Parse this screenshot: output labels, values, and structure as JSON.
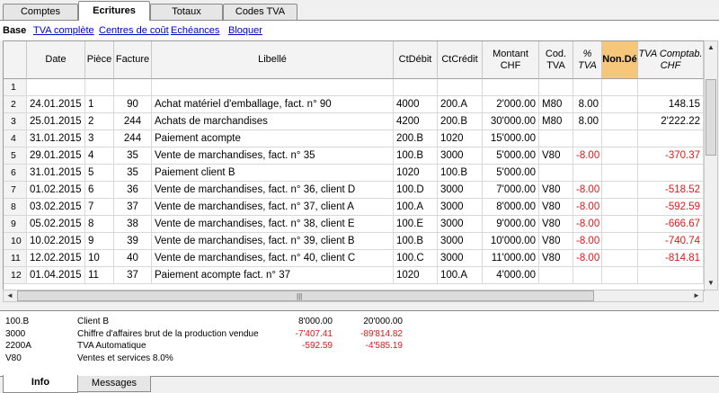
{
  "top_tabs": [
    "Comptes",
    "Ecritures",
    "Totaux",
    "Codes TVA"
  ],
  "active_top_tab": 1,
  "views": {
    "base": "Base",
    "links": [
      "TVA complète",
      "Centres de coût",
      "Echéances",
      "Bloquer"
    ]
  },
  "columns": [
    {
      "key": "date",
      "label": "Date"
    },
    {
      "key": "piece",
      "label": "Pièce"
    },
    {
      "key": "facture",
      "label": "Facture"
    },
    {
      "key": "libelle",
      "label": "Libellé"
    },
    {
      "key": "ctdebit",
      "label": "CtDébit"
    },
    {
      "key": "ctcredit",
      "label": "CtCrédit"
    },
    {
      "key": "montant",
      "label": "Montant CHF"
    },
    {
      "key": "codtva",
      "label": "Cod. TVA"
    },
    {
      "key": "pct",
      "label": "% TVA"
    },
    {
      "key": "nonde",
      "label": "Non.Dé"
    },
    {
      "key": "tvacompta",
      "label": "TVA Comptab. CHF"
    }
  ],
  "rows": [
    {
      "n": "1",
      "date": "",
      "piece": "",
      "facture": "",
      "libelle": "",
      "ctdebit": "",
      "ctcredit": "",
      "montant": "",
      "codtva": "",
      "pct": "",
      "nonde": "",
      "tvacompta": ""
    },
    {
      "n": "2",
      "date": "24.01.2015",
      "piece": "1",
      "facture": "90",
      "libelle": "Achat matériel d'emballage, fact. n° 90",
      "ctdebit": "4000",
      "ctcredit": "200.A",
      "montant": "2'000.00",
      "codtva": "M80",
      "pct": "8.00",
      "nonde": "",
      "tvacompta": "148.15"
    },
    {
      "n": "3",
      "date": "25.01.2015",
      "piece": "2",
      "facture": "244",
      "libelle": "Achats de marchandises",
      "ctdebit": "4200",
      "ctcredit": "200.B",
      "montant": "30'000.00",
      "codtva": "M80",
      "pct": "8.00",
      "nonde": "",
      "tvacompta": "2'222.22"
    },
    {
      "n": "4",
      "date": "31.01.2015",
      "piece": "3",
      "facture": "244",
      "libelle": "Paiement acompte",
      "ctdebit": "200.B",
      "ctcredit": "1020",
      "montant": "15'000.00",
      "codtva": "",
      "pct": "",
      "nonde": "",
      "tvacompta": ""
    },
    {
      "n": "5",
      "date": "29.01.2015",
      "piece": "4",
      "facture": "35",
      "libelle": "Vente de marchandises, fact. n° 35",
      "ctdebit": "100.B",
      "ctcredit": "3000",
      "montant": "5'000.00",
      "codtva": "V80",
      "pct": "-8.00",
      "nonde": "",
      "tvacompta": "-370.37"
    },
    {
      "n": "6",
      "date": "31.01.2015",
      "piece": "5",
      "facture": "35",
      "libelle": "Paiement client B",
      "ctdebit": "1020",
      "ctcredit": "100.B",
      "montant": "5'000.00",
      "codtva": "",
      "pct": "",
      "nonde": "",
      "tvacompta": ""
    },
    {
      "n": "7",
      "date": "01.02.2015",
      "piece": "6",
      "facture": "36",
      "libelle": "Vente de marchandises, fact. n° 36, client D",
      "ctdebit": "100.D",
      "ctcredit": "3000",
      "montant": "7'000.00",
      "codtva": "V80",
      "pct": "-8.00",
      "nonde": "",
      "tvacompta": "-518.52"
    },
    {
      "n": "8",
      "date": "03.02.2015",
      "piece": "7",
      "facture": "37",
      "libelle": "Vente de marchandises, fact. n° 37, client A",
      "ctdebit": "100.A",
      "ctcredit": "3000",
      "montant": "8'000.00",
      "codtva": "V80",
      "pct": "-8.00",
      "nonde": "",
      "tvacompta": "-592.59"
    },
    {
      "n": "9",
      "date": "05.02.2015",
      "piece": "8",
      "facture": "38",
      "libelle": "Vente de marchandises, fact. n° 38, client E",
      "ctdebit": "100.E",
      "ctcredit": "3000",
      "montant": "9'000.00",
      "codtva": "V80",
      "pct": "-8.00",
      "nonde": "",
      "tvacompta": "-666.67"
    },
    {
      "n": "10",
      "date": "10.02.2015",
      "piece": "9",
      "facture": "39",
      "libelle": "Vente de marchandises, fact. n° 39, client B",
      "ctdebit": "100.B",
      "ctcredit": "3000",
      "montant": "10'000.00",
      "codtva": "V80",
      "pct": "-8.00",
      "nonde": "",
      "tvacompta": "-740.74"
    },
    {
      "n": "11",
      "date": "12.02.2015",
      "piece": "10",
      "facture": "40",
      "libelle": "Vente de marchandises, fact. n° 40, client C",
      "ctdebit": "100.C",
      "ctcredit": "3000",
      "montant": "11'000.00",
      "codtva": "V80",
      "pct": "-8.00",
      "nonde": "",
      "tvacompta": "-814.81"
    },
    {
      "n": "12",
      "date": "01.04.2015",
      "piece": "11",
      "facture": "37",
      "libelle": "Paiement acompte fact. n° 37",
      "ctdebit": "1020",
      "ctcredit": "100.A",
      "montant": "4'000.00",
      "codtva": "",
      "pct": "",
      "nonde": "",
      "tvacompta": ""
    }
  ],
  "info_rows": [
    {
      "code": "100.B",
      "desc": "Client B",
      "v1": "8'000.00",
      "v2": "20'000.00"
    },
    {
      "code": "3000",
      "desc": "Chiffre d'affaires brut de la production vendue",
      "v1": "-7'407.41",
      "v2": "-89'814.82"
    },
    {
      "code": "2200A",
      "desc": "TVA Automatique",
      "v1": "-592.59",
      "v2": "-4'585.19"
    },
    {
      "code": "V80",
      "desc": "Ventes et services 8.0%",
      "v1": "",
      "v2": ""
    }
  ],
  "bottom_tabs": [
    "Info",
    "Messages"
  ],
  "active_bottom_tab": 0,
  "icons": {
    "scroll_up": "▲",
    "scroll_down": "▼",
    "scroll_left": "◄",
    "scroll_right": "►",
    "grip": "|||"
  },
  "colors": {
    "negative": "#e01818",
    "link": "#0000cc",
    "highlight_header": "#f6c67a"
  }
}
